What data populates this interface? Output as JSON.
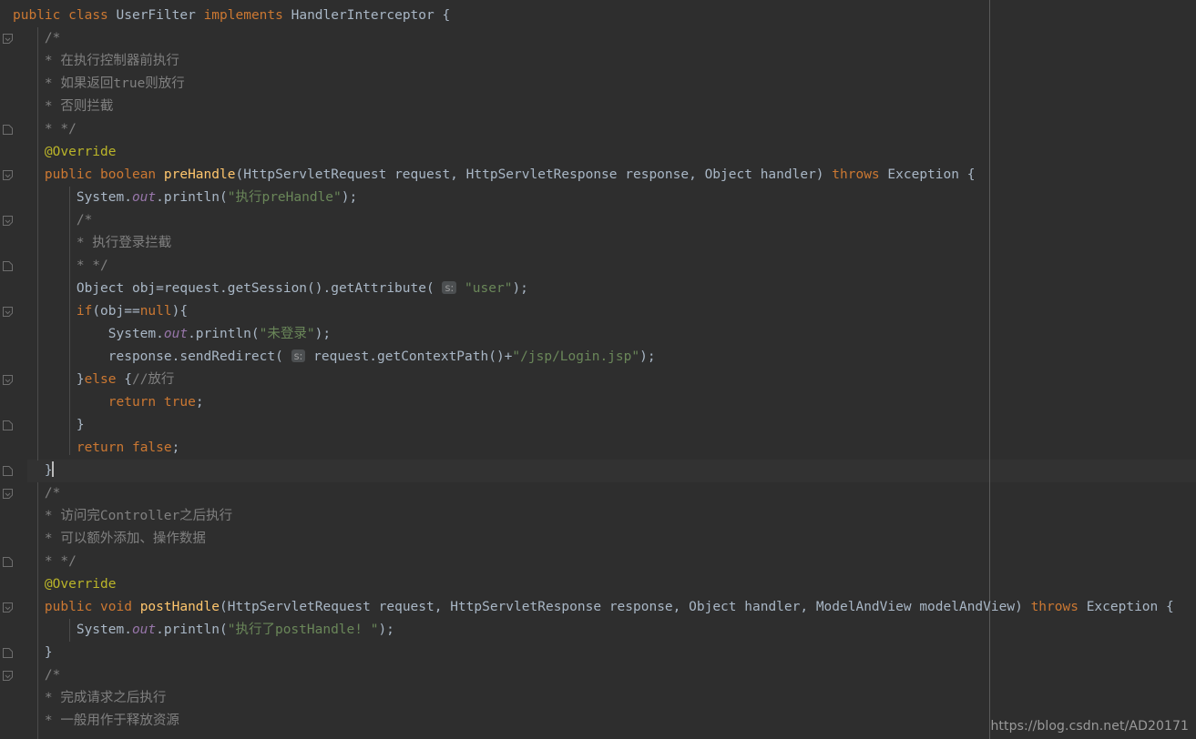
{
  "editor": {
    "background": "#2e2e2e",
    "caret_line_background": "#323232",
    "right_margin_x": 1086,
    "line_height": 25,
    "font_size": 14.5
  },
  "colors": {
    "keyword": "#cc7832",
    "identifier": "#a9b7c6",
    "comment": "#808080",
    "string": "#6a8759",
    "annotation": "#bbb529",
    "method": "#ffc66d",
    "static_field": "#9876aa",
    "guide": "#4b4b4b",
    "right_margin": "#5a5a5a",
    "caret": "#bbbbbb",
    "hint_badge_bg": "#4c4f51",
    "hint_badge_fg": "#9c9c9c"
  },
  "watermark": {
    "text": "https://blog.csdn.net/AD20171"
  },
  "hints": {
    "string_param": "s:"
  },
  "code": {
    "language": "java",
    "class_name": "UserFilter",
    "interface_name": "HandlerInterceptor",
    "lines": [
      {
        "n": 1,
        "text": "public class UserFilter implements HandlerInterceptor {"
      },
      {
        "n": 2,
        "text": "    /*"
      },
      {
        "n": 3,
        "text": "    * 在执行控制器前执行"
      },
      {
        "n": 4,
        "text": "    * 如果返回true则放行"
      },
      {
        "n": 5,
        "text": "    * 否则拦截"
      },
      {
        "n": 6,
        "text": "    * */"
      },
      {
        "n": 7,
        "text": "    @Override"
      },
      {
        "n": 8,
        "text": "    public boolean preHandle(HttpServletRequest request, HttpServletResponse response, Object handler) throws Exception {"
      },
      {
        "n": 9,
        "text": "        System.out.println(\"执行preHandle\");"
      },
      {
        "n": 10,
        "text": "        /*"
      },
      {
        "n": 11,
        "text": "        * 执行登录拦截"
      },
      {
        "n": 12,
        "text": "        * */"
      },
      {
        "n": 13,
        "text": "        Object obj=request.getSession().getAttribute( s: \"user\");"
      },
      {
        "n": 14,
        "text": "        if(obj==null){"
      },
      {
        "n": 15,
        "text": "            System.out.println(\"未登录\");"
      },
      {
        "n": 16,
        "text": "            response.sendRedirect( s: request.getContextPath()+\"/jsp/Login.jsp\");"
      },
      {
        "n": 17,
        "text": "        }else {//放行"
      },
      {
        "n": 18,
        "text": "            return true;"
      },
      {
        "n": 19,
        "text": "        }"
      },
      {
        "n": 20,
        "text": "        return false;"
      },
      {
        "n": 21,
        "text": "    }"
      },
      {
        "n": 22,
        "text": "    /*"
      },
      {
        "n": 23,
        "text": "    * 访问完Controller之后执行"
      },
      {
        "n": 24,
        "text": "    * 可以额外添加、操作数据"
      },
      {
        "n": 25,
        "text": "    * */"
      },
      {
        "n": 26,
        "text": "    @Override"
      },
      {
        "n": 27,
        "text": "    public void postHandle(HttpServletRequest request, HttpServletResponse response, Object handler, ModelAndView modelAndView) throws Exception"
      },
      {
        "n": 28,
        "text": "        System.out.println(\"执行了postHandle! \");"
      },
      {
        "n": 29,
        "text": "    }"
      },
      {
        "n": 30,
        "text": "    /*"
      },
      {
        "n": 31,
        "text": "    * 完成请求之后执行"
      },
      {
        "n": 32,
        "text": "    * 一般用作于释放资源"
      }
    ],
    "caret_line_number": 21,
    "fold_marker_lines": [
      2,
      6,
      8,
      10,
      12,
      14,
      17,
      19,
      21,
      22,
      25,
      27,
      29,
      30
    ]
  }
}
